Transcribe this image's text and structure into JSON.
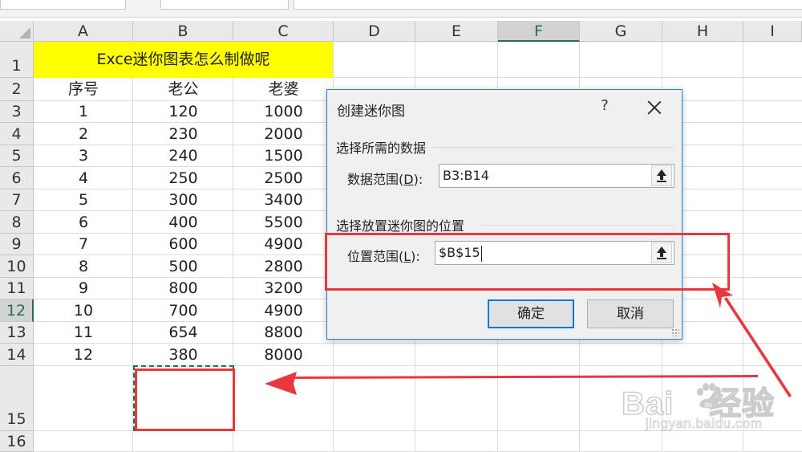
{
  "columns": [
    "A",
    "B",
    "C",
    "D",
    "E",
    "F",
    "G",
    "H",
    "I"
  ],
  "selected_column": "F",
  "rows": [
    "1",
    "2",
    "3",
    "4",
    "5",
    "6",
    "7",
    "8",
    "9",
    "10",
    "11",
    "12",
    "13",
    "14",
    "15",
    "16"
  ],
  "selected_row": "12",
  "sheet": {
    "title": "Exce迷你图表怎么制做呢",
    "headers": [
      "序号",
      "老公",
      "老婆"
    ],
    "data": [
      [
        "1",
        "120",
        "1000"
      ],
      [
        "2",
        "230",
        "2000"
      ],
      [
        "3",
        "240",
        "1500"
      ],
      [
        "4",
        "250",
        "2500"
      ],
      [
        "5",
        "300",
        "3400"
      ],
      [
        "6",
        "400",
        "5500"
      ],
      [
        "7",
        "600",
        "4900"
      ],
      [
        "8",
        "500",
        "2800"
      ],
      [
        "9",
        "800",
        "3200"
      ],
      [
        "10",
        "700",
        "4900"
      ],
      [
        "11",
        "654",
        "8800"
      ],
      [
        "12",
        "380",
        "8000"
      ]
    ]
  },
  "dialog": {
    "title": "创建迷你图",
    "help": "?",
    "section_data": "选择所需的数据",
    "data_range_label": "数据范围(",
    "data_range_key": "D",
    "data_range_suffix": "):",
    "data_range_value": "B3:B14",
    "section_location": "选择放置迷你图的位置",
    "location_range_label": "位置范围(",
    "location_range_key": "L",
    "location_range_suffix": "):",
    "location_range_value": "$B$15",
    "ok": "确定",
    "cancel": "取消"
  },
  "colors": {
    "title_fill": "#ffff00",
    "annotation_red": "#e8383d",
    "excel_green": "#217346",
    "dialog_border": "#1883d7"
  },
  "watermark": {
    "main_left": "Bai",
    "main_right": "经验",
    "paw_text": "du",
    "sub": "jingyan.baidu.com"
  }
}
